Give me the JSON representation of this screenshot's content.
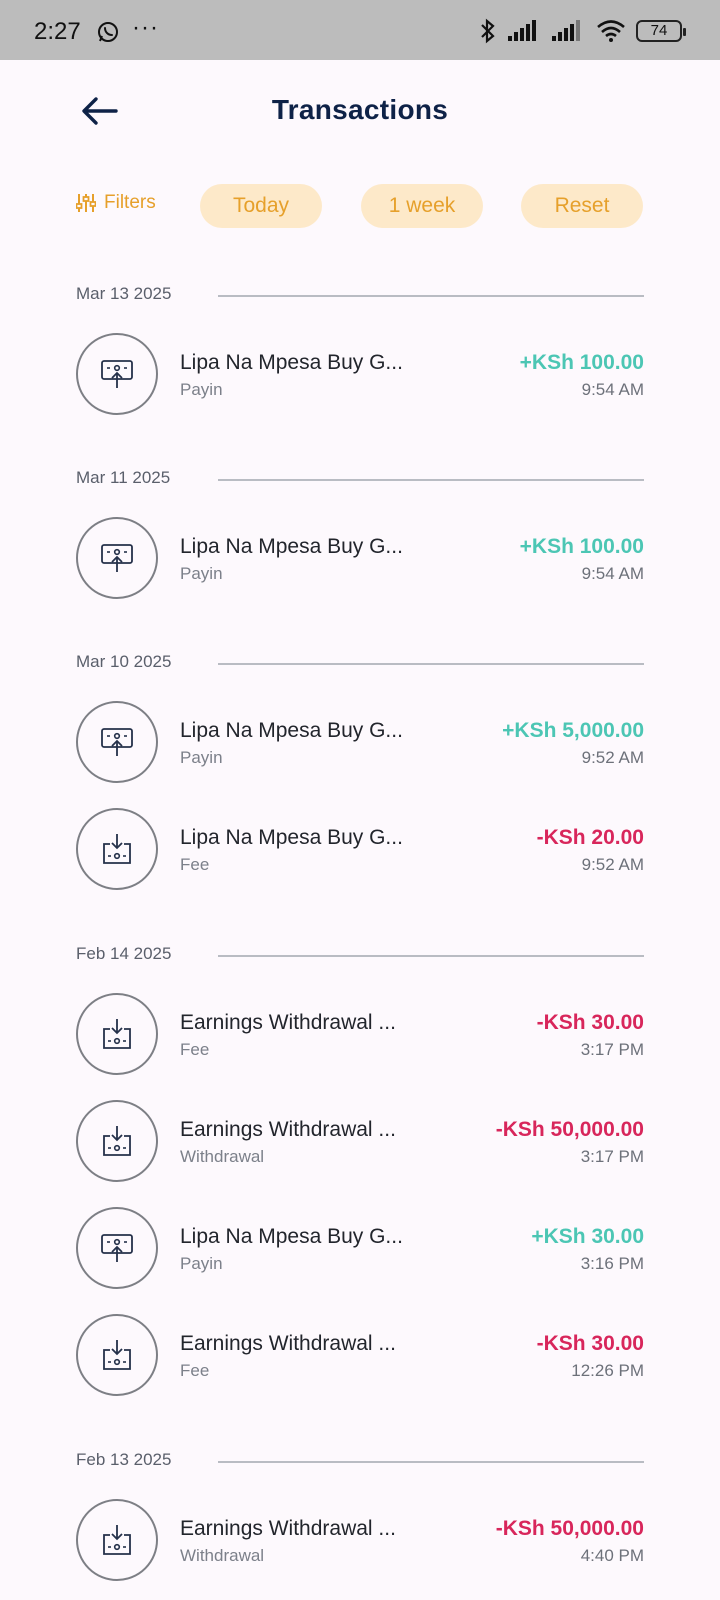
{
  "status_bar": {
    "time": "2:27",
    "more": "···",
    "battery": "74"
  },
  "header": {
    "title": "Transactions"
  },
  "filters": {
    "filters_label": "Filters",
    "chips": [
      "Today",
      "1 week",
      "Reset"
    ]
  },
  "groups": [
    {
      "date": "Mar 13 2025",
      "items": [
        {
          "name": "Lipa Na Mpesa Buy G...",
          "type": "Payin",
          "amount": "+KSh  100.00",
          "time": "9:54 AM",
          "direction": "in"
        }
      ]
    },
    {
      "date": "Mar 11 2025",
      "items": [
        {
          "name": "Lipa Na Mpesa Buy G...",
          "type": "Payin",
          "amount": "+KSh  100.00",
          "time": "9:54 AM",
          "direction": "in"
        }
      ]
    },
    {
      "date": "Mar 10 2025",
      "items": [
        {
          "name": "Lipa Na Mpesa Buy G...",
          "type": "Payin",
          "amount": "+KSh  5,000.00",
          "time": "9:52 AM",
          "direction": "in"
        },
        {
          "name": "Lipa Na Mpesa Buy G...",
          "type": "Fee",
          "amount": "-KSh 20.00",
          "time": "9:52 AM",
          "direction": "out"
        }
      ]
    },
    {
      "date": "Feb 14 2025",
      "items": [
        {
          "name": "Earnings Withdrawal ...",
          "type": "Fee",
          "amount": "-KSh 30.00",
          "time": "3:17 PM",
          "direction": "out"
        },
        {
          "name": "Earnings Withdrawal ...",
          "type": "Withdrawal",
          "amount": "-KSh 50,000.00",
          "time": "3:17 PM",
          "direction": "out"
        },
        {
          "name": "Lipa Na Mpesa Buy G...",
          "type": "Payin",
          "amount": "+KSh  30.00",
          "time": "3:16 PM",
          "direction": "in"
        },
        {
          "name": "Earnings Withdrawal ...",
          "type": "Fee",
          "amount": "-KSh 30.00",
          "time": "12:26 PM",
          "direction": "out"
        }
      ]
    },
    {
      "date": "Feb 13 2025",
      "items": [
        {
          "name": "Earnings Withdrawal ...",
          "type": "Withdrawal",
          "amount": "-KSh 50,000.00",
          "time": "4:40 PM",
          "direction": "out"
        }
      ]
    }
  ],
  "colors": {
    "accent": "#e6a02b",
    "chip_bg": "#fde9c9",
    "positive": "#4cc6b4",
    "negative": "#d8265b",
    "title": "#0e2247"
  }
}
